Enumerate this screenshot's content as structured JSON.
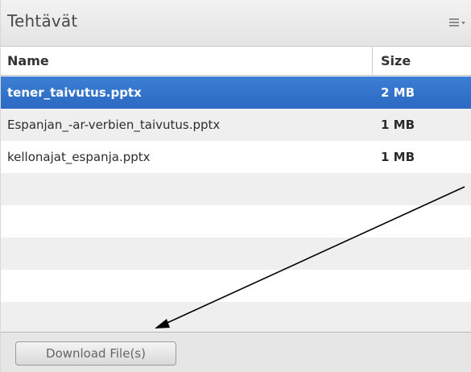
{
  "panel": {
    "title": "Tehtävät",
    "menu_icon": "list-menu-icon"
  },
  "table": {
    "columns": {
      "name": "Name",
      "size": "Size"
    },
    "rows": [
      {
        "name": "tener_taivutus.pptx",
        "size": "2 MB",
        "selected": true
      },
      {
        "name": "Espanjan_-ar-verbien_taivutus.pptx",
        "size": "1 MB",
        "selected": false
      },
      {
        "name": "kellonajat_espanja.pptx",
        "size": "1 MB",
        "selected": false
      },
      {
        "name": "",
        "size": "",
        "selected": false
      },
      {
        "name": "",
        "size": "",
        "selected": false
      },
      {
        "name": "",
        "size": "",
        "selected": false
      },
      {
        "name": "",
        "size": "",
        "selected": false
      },
      {
        "name": "",
        "size": "",
        "selected": false
      }
    ]
  },
  "footer": {
    "download_label": "Download File(s)"
  },
  "colors": {
    "selection": "#2f6fc8",
    "annotation_arrow": "#000000"
  }
}
